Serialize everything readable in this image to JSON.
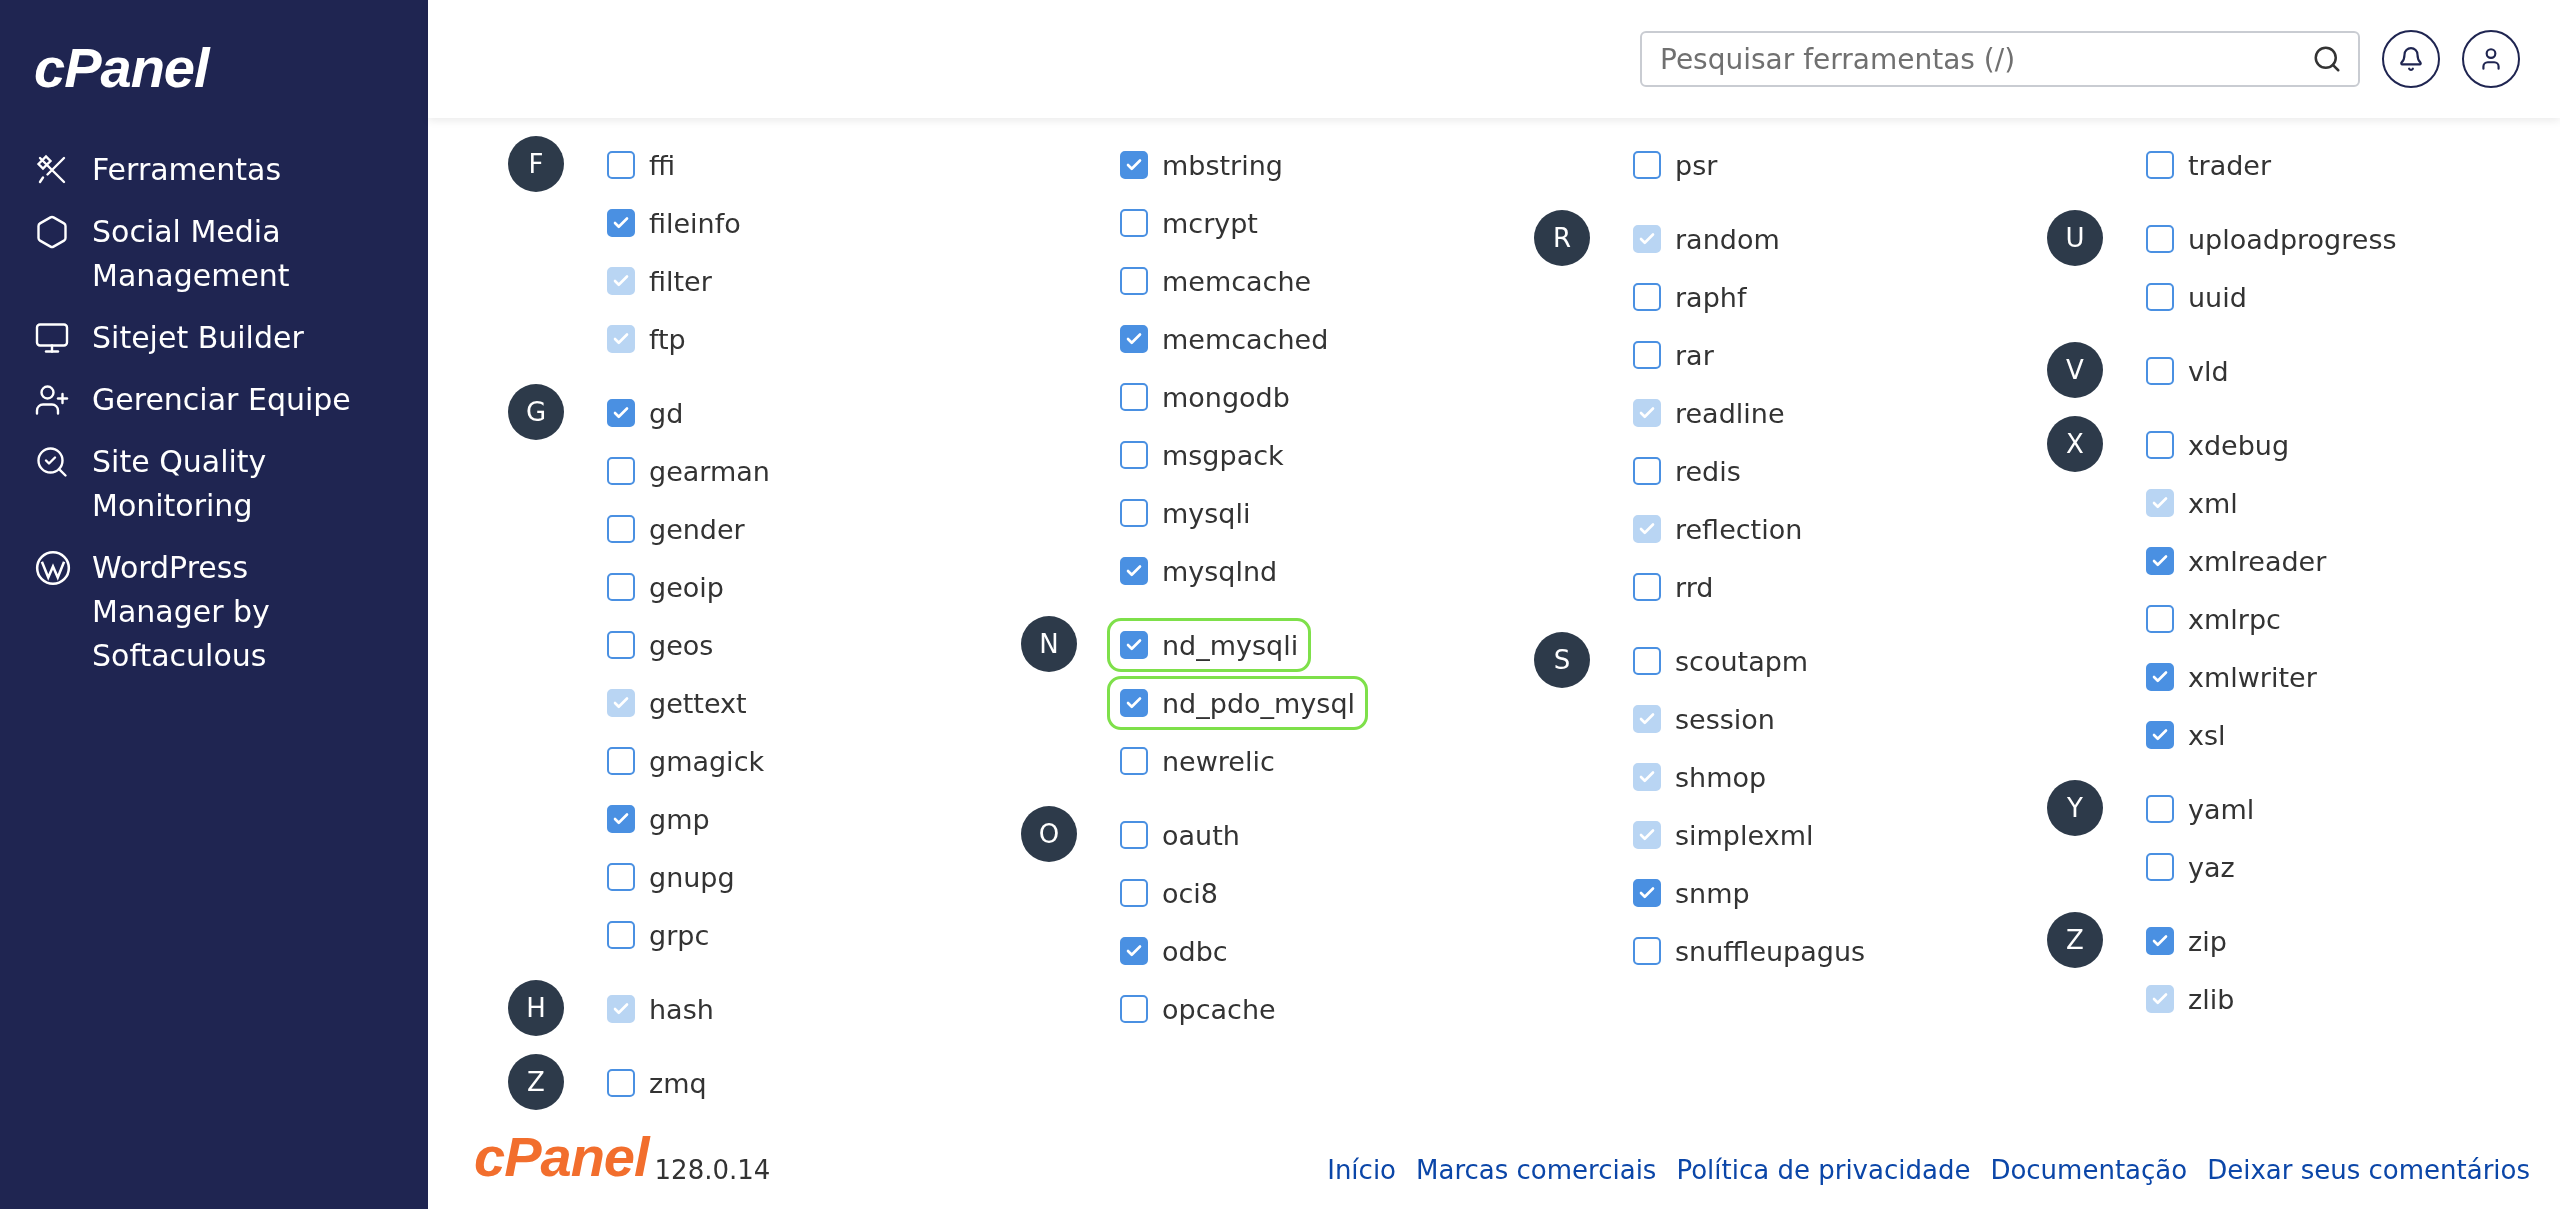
{
  "sidebar": {
    "logo": "cPanel",
    "items": [
      {
        "label": "Ferramentas"
      },
      {
        "label": "Social Media Management"
      },
      {
        "label": "Sitejet Builder"
      },
      {
        "label": "Gerenciar Equipe"
      },
      {
        "label": "Site Quality Monitoring"
      },
      {
        "label": "WordPress Manager by Softaculous"
      }
    ]
  },
  "search": {
    "placeholder": "Pesquisar ferramentas (/)"
  },
  "columns": [
    {
      "groups": [
        {
          "letter": "F",
          "items": [
            {
              "name": "ffi",
              "checked": false,
              "disabled": false,
              "highlighted": false
            },
            {
              "name": "fileinfo",
              "checked": true,
              "disabled": false,
              "highlighted": false
            },
            {
              "name": "filter",
              "checked": true,
              "disabled": true,
              "highlighted": false
            },
            {
              "name": "ftp",
              "checked": true,
              "disabled": true,
              "highlighted": false
            }
          ]
        },
        {
          "letter": "G",
          "items": [
            {
              "name": "gd",
              "checked": true,
              "disabled": false,
              "highlighted": false
            },
            {
              "name": "gearman",
              "checked": false,
              "disabled": false,
              "highlighted": false
            },
            {
              "name": "gender",
              "checked": false,
              "disabled": false,
              "highlighted": false
            },
            {
              "name": "geoip",
              "checked": false,
              "disabled": false,
              "highlighted": false
            },
            {
              "name": "geos",
              "checked": false,
              "disabled": false,
              "highlighted": false
            },
            {
              "name": "gettext",
              "checked": true,
              "disabled": true,
              "highlighted": false
            },
            {
              "name": "gmagick",
              "checked": false,
              "disabled": false,
              "highlighted": false
            },
            {
              "name": "gmp",
              "checked": true,
              "disabled": false,
              "highlighted": false
            },
            {
              "name": "gnupg",
              "checked": false,
              "disabled": false,
              "highlighted": false
            },
            {
              "name": "grpc",
              "checked": false,
              "disabled": false,
              "highlighted": false
            }
          ]
        },
        {
          "letter": "H",
          "items": [
            {
              "name": "hash",
              "checked": true,
              "disabled": true,
              "highlighted": false
            }
          ]
        },
        {
          "letter": "Z",
          "items": [
            {
              "name": "zmq",
              "checked": false,
              "disabled": false,
              "highlighted": false
            }
          ]
        }
      ]
    },
    {
      "groups": [
        {
          "items": [
            {
              "name": "mbstring",
              "checked": true,
              "disabled": false,
              "highlighted": false
            },
            {
              "name": "mcrypt",
              "checked": false,
              "disabled": false,
              "highlighted": false
            },
            {
              "name": "memcache",
              "checked": false,
              "disabled": false,
              "highlighted": false
            },
            {
              "name": "memcached",
              "checked": true,
              "disabled": false,
              "highlighted": false
            },
            {
              "name": "mongodb",
              "checked": false,
              "disabled": false,
              "highlighted": false
            },
            {
              "name": "msgpack",
              "checked": false,
              "disabled": false,
              "highlighted": false
            },
            {
              "name": "mysqli",
              "checked": false,
              "disabled": false,
              "highlighted": false
            },
            {
              "name": "mysqlnd",
              "checked": true,
              "disabled": false,
              "highlighted": false
            }
          ]
        },
        {
          "letter": "N",
          "items": [
            {
              "name": "nd_mysqli",
              "checked": true,
              "disabled": false,
              "highlighted": true
            },
            {
              "name": "nd_pdo_mysql",
              "checked": true,
              "disabled": false,
              "highlighted": true
            },
            {
              "name": "newrelic",
              "checked": false,
              "disabled": false,
              "highlighted": false
            }
          ]
        },
        {
          "letter": "O",
          "items": [
            {
              "name": "oauth",
              "checked": false,
              "disabled": false,
              "highlighted": false
            },
            {
              "name": "oci8",
              "checked": false,
              "disabled": false,
              "highlighted": false
            },
            {
              "name": "odbc",
              "checked": true,
              "disabled": false,
              "highlighted": false
            },
            {
              "name": "opcache",
              "checked": false,
              "disabled": false,
              "highlighted": false
            }
          ]
        }
      ]
    },
    {
      "groups": [
        {
          "items": [
            {
              "name": "psr",
              "checked": false,
              "disabled": false,
              "highlighted": false
            }
          ]
        },
        {
          "letter": "R",
          "items": [
            {
              "name": "random",
              "checked": true,
              "disabled": true,
              "highlighted": false
            },
            {
              "name": "raphf",
              "checked": false,
              "disabled": false,
              "highlighted": false
            },
            {
              "name": "rar",
              "checked": false,
              "disabled": false,
              "highlighted": false
            },
            {
              "name": "readline",
              "checked": true,
              "disabled": true,
              "highlighted": false
            },
            {
              "name": "redis",
              "checked": false,
              "disabled": false,
              "highlighted": false
            },
            {
              "name": "reflection",
              "checked": true,
              "disabled": true,
              "highlighted": false
            },
            {
              "name": "rrd",
              "checked": false,
              "disabled": false,
              "highlighted": false
            }
          ]
        },
        {
          "letter": "S",
          "items": [
            {
              "name": "scoutapm",
              "checked": false,
              "disabled": false,
              "highlighted": false
            },
            {
              "name": "session",
              "checked": true,
              "disabled": true,
              "highlighted": false
            },
            {
              "name": "shmop",
              "checked": true,
              "disabled": true,
              "highlighted": false
            },
            {
              "name": "simplexml",
              "checked": true,
              "disabled": true,
              "highlighted": false
            },
            {
              "name": "snmp",
              "checked": true,
              "disabled": false,
              "highlighted": false
            },
            {
              "name": "snuffleupagus",
              "checked": false,
              "disabled": false,
              "highlighted": false
            }
          ]
        }
      ]
    },
    {
      "groups": [
        {
          "items": [
            {
              "name": "trader",
              "checked": false,
              "disabled": false,
              "highlighted": false
            }
          ]
        },
        {
          "letter": "U",
          "items": [
            {
              "name": "uploadprogress",
              "checked": false,
              "disabled": false,
              "highlighted": false
            },
            {
              "name": "uuid",
              "checked": false,
              "disabled": false,
              "highlighted": false
            }
          ]
        },
        {
          "letter": "V",
          "items": [
            {
              "name": "vld",
              "checked": false,
              "disabled": false,
              "highlighted": false
            }
          ]
        },
        {
          "letter": "X",
          "items": [
            {
              "name": "xdebug",
              "checked": false,
              "disabled": false,
              "highlighted": false
            },
            {
              "name": "xml",
              "checked": true,
              "disabled": true,
              "highlighted": false
            },
            {
              "name": "xmlreader",
              "checked": true,
              "disabled": false,
              "highlighted": false
            },
            {
              "name": "xmlrpc",
              "checked": false,
              "disabled": false,
              "highlighted": false
            },
            {
              "name": "xmlwriter",
              "checked": true,
              "disabled": false,
              "highlighted": false
            },
            {
              "name": "xsl",
              "checked": true,
              "disabled": false,
              "highlighted": false
            }
          ]
        },
        {
          "letter": "Y",
          "items": [
            {
              "name": "yaml",
              "checked": false,
              "disabled": false,
              "highlighted": false
            },
            {
              "name": "yaz",
              "checked": false,
              "disabled": false,
              "highlighted": false
            }
          ]
        },
        {
          "letter": "Z",
          "items": [
            {
              "name": "zip",
              "checked": true,
              "disabled": false,
              "highlighted": false
            },
            {
              "name": "zlib",
              "checked": true,
              "disabled": true,
              "highlighted": false
            }
          ]
        }
      ]
    }
  ],
  "footer": {
    "logo": "cPanel",
    "version": "128.0.14",
    "links": [
      "Início",
      "Marcas comerciais",
      "Política de privacidade",
      "Documentação",
      "Deixar seus comentários"
    ]
  }
}
